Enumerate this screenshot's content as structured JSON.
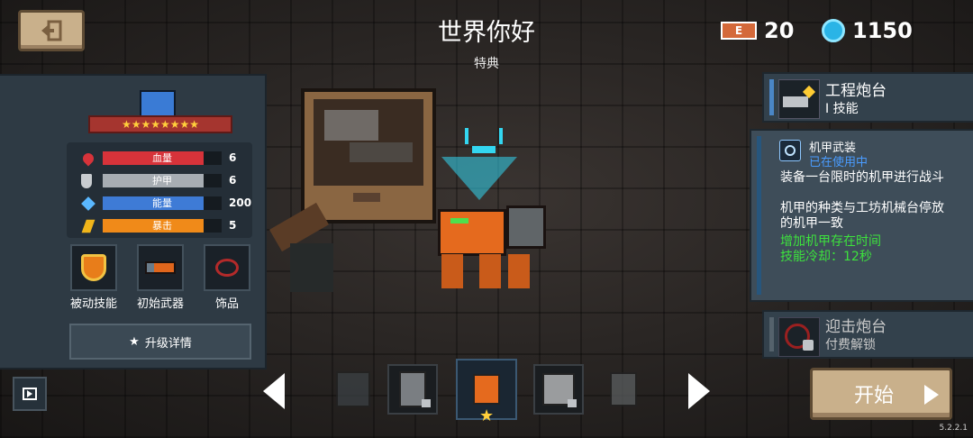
{
  "header": {
    "title": "世界你好",
    "subtitle": "特典"
  },
  "resources": {
    "energy": "20",
    "gems": "1150"
  },
  "character": {
    "stars": "★★★★★★★★",
    "stats": [
      {
        "label": "血量",
        "value": "6",
        "fill": 0.85,
        "color": "#d7333a"
      },
      {
        "label": "护甲",
        "value": "6",
        "fill": 0.85,
        "color": "#a7adb3"
      },
      {
        "label": "能量",
        "value": "200",
        "fill": 0.85,
        "color": "#3e7bd6"
      },
      {
        "label": "暴击",
        "value": "5",
        "fill": 0.85,
        "color": "#f08a19"
      }
    ],
    "slots": {
      "passive": "被动技能",
      "weapon": "初始武器",
      "accessory": "饰品"
    },
    "upgrade_label": "升级详情"
  },
  "skills": {
    "current": {
      "name": "工程炮台",
      "sub": "I 技能"
    },
    "detail": {
      "name": "机甲武装",
      "status": "已在使用中",
      "desc1": "装备一台限时的机甲进行战斗",
      "desc2": "机甲的种类与工坊机械台停放的机甲一致",
      "bonus1": "增加机甲存在时间",
      "bonus2": "技能冷却：12秒"
    },
    "locked": {
      "name": "迎击炮台",
      "sub": "付费解锁"
    }
  },
  "start_label": "开始",
  "version": "5.2.2.1",
  "colors": {
    "accent_blue": "#4a86c7",
    "bonus_green": "#3de23d",
    "button_tan": "#c9b08b"
  }
}
